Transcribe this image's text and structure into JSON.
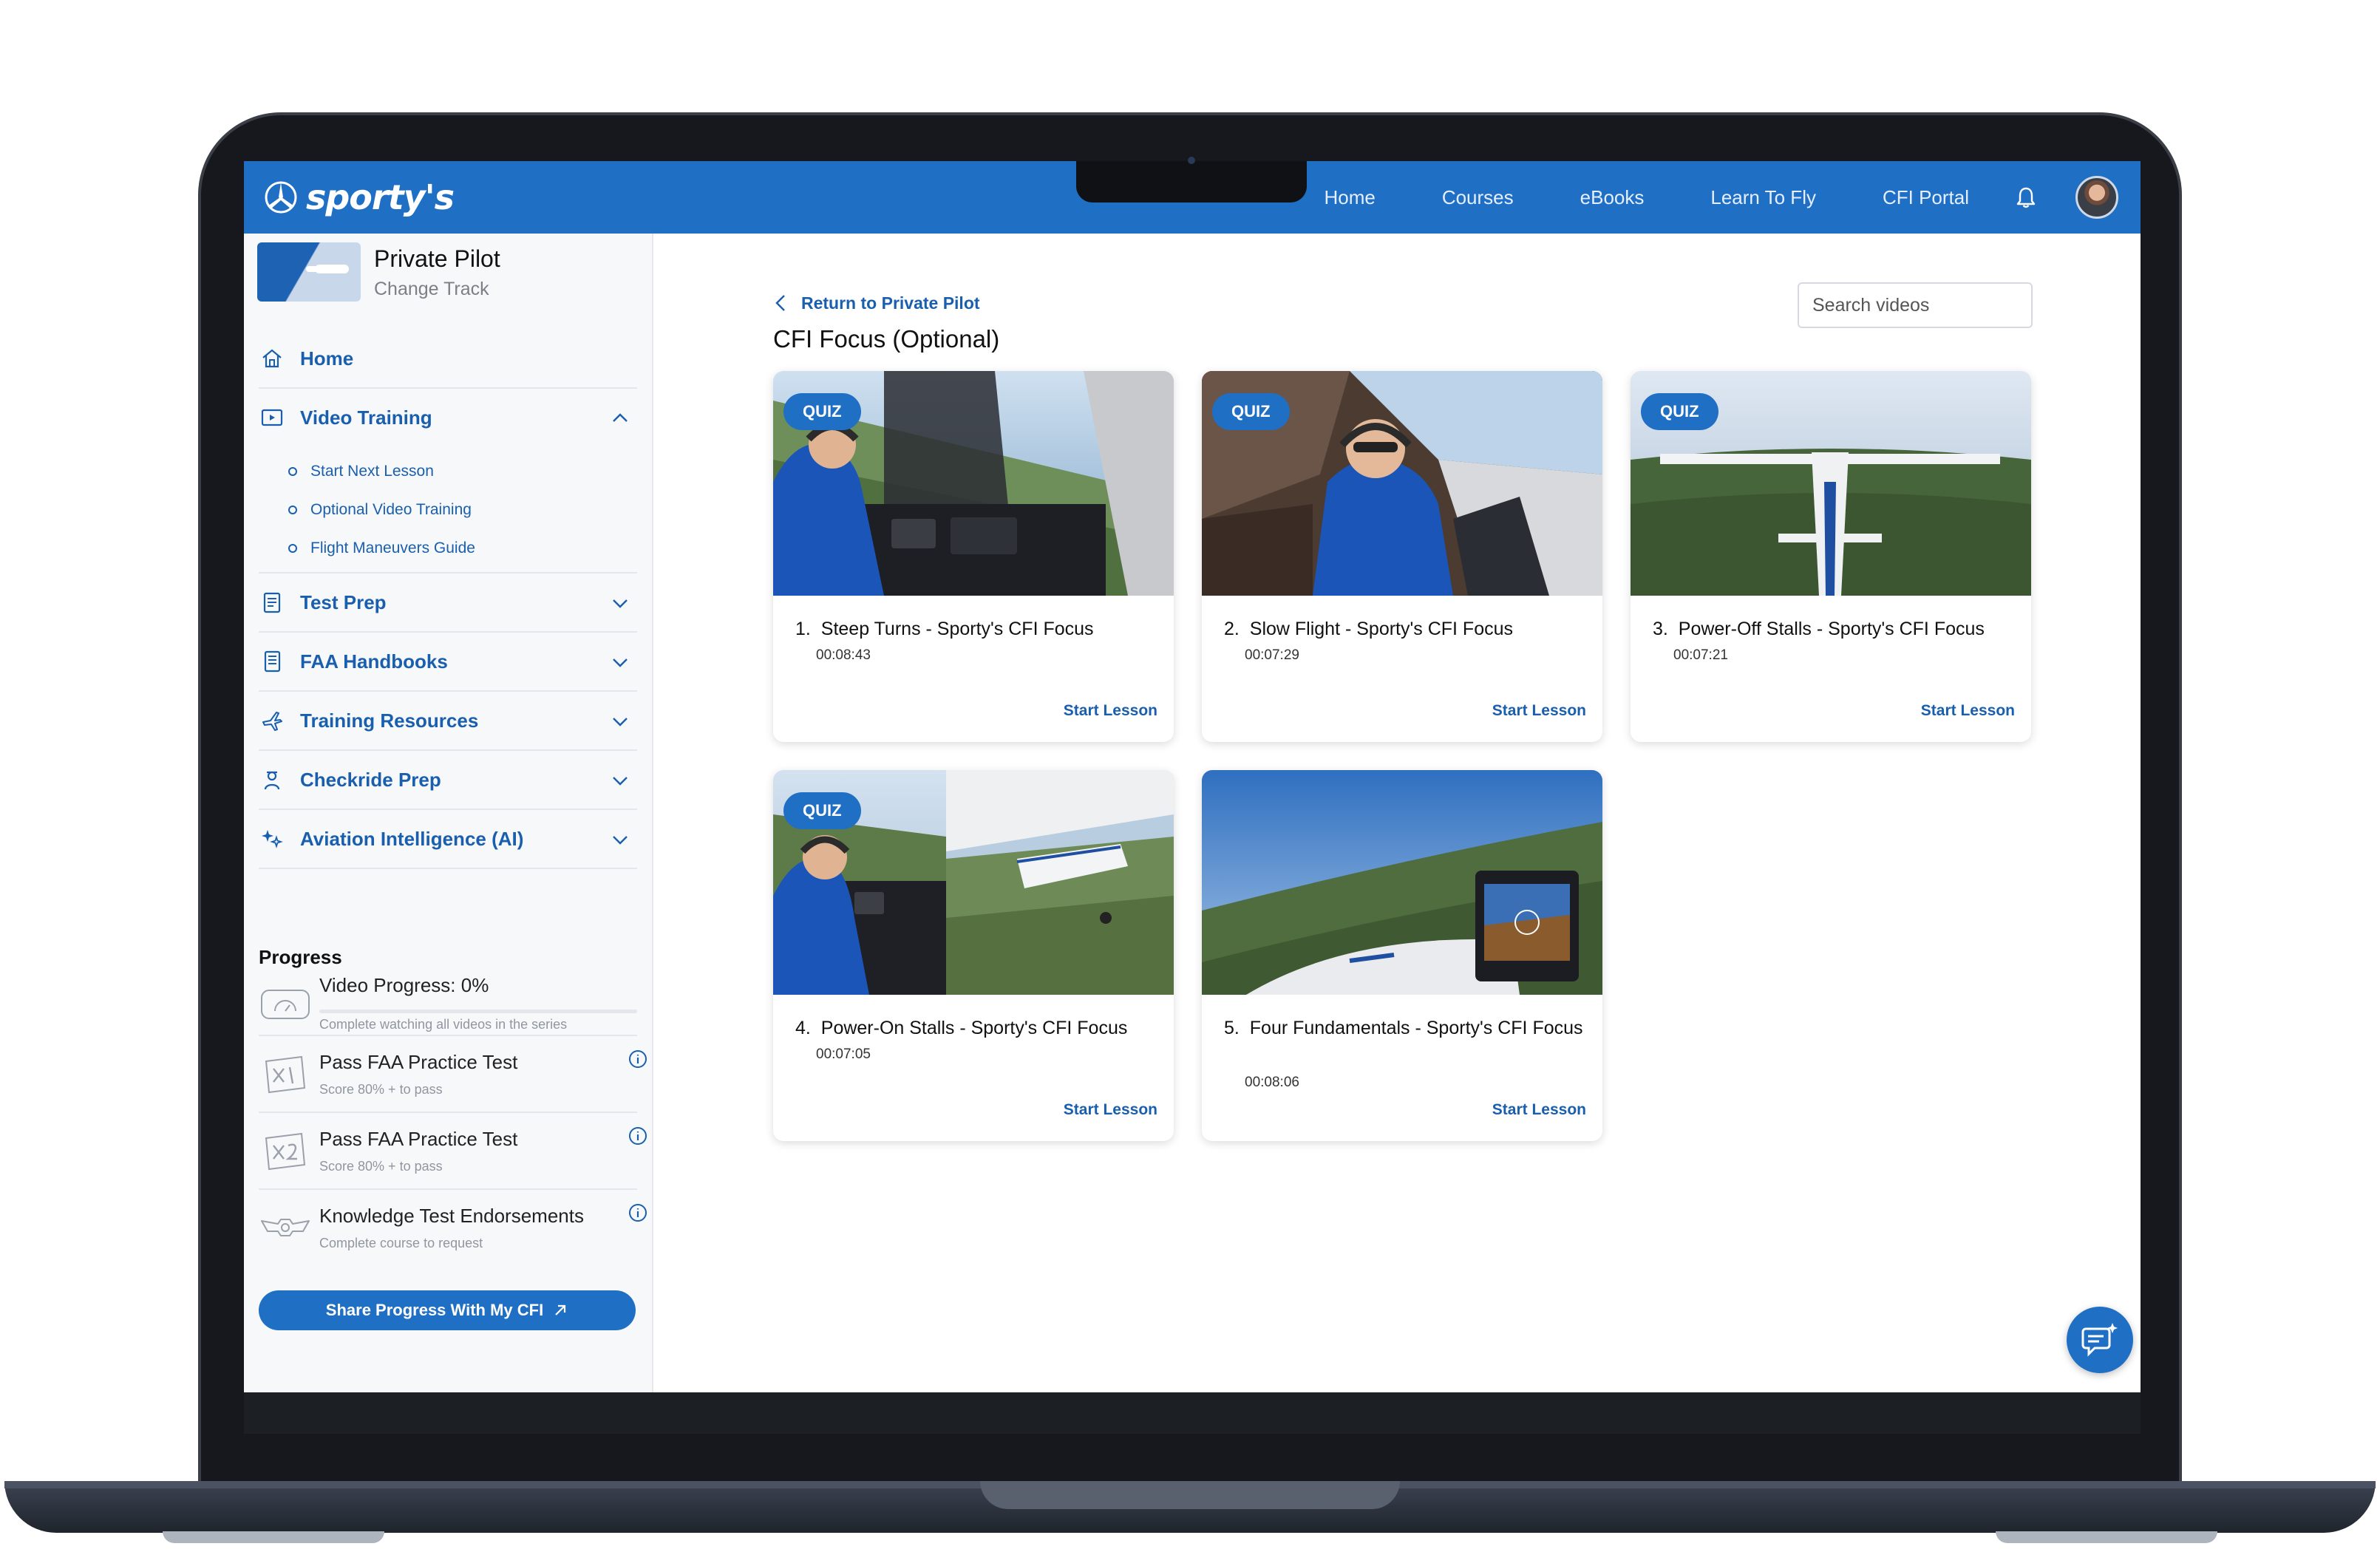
{
  "topnav": {
    "logo_text": "sporty's",
    "links": [
      "Home",
      "Courses",
      "eBooks",
      "Learn To Fly",
      "CFI Portal"
    ],
    "bell_icon": "bell-icon",
    "avatar_icon": "user-avatar"
  },
  "sidebar": {
    "track": {
      "title": "Private Pilot",
      "subtitle": "Change Track"
    },
    "home_label": "Home",
    "video_training": {
      "label": "Video Training",
      "subitems": [
        "Start Next Lesson",
        "Optional Video Training",
        "Flight Maneuvers Guide"
      ]
    },
    "sections": [
      "Test Prep",
      "FAA Handbooks",
      "Training Resources",
      "Checkride Prep",
      "Aviation Intelligence (AI)"
    ],
    "progress": {
      "title": "Progress",
      "items": [
        {
          "title": "Video Progress: 0%",
          "subtitle": "Complete watching all videos in the series",
          "value": 0
        },
        {
          "title": "Pass FAA Practice Test",
          "subtitle": "Score 80% + to pass"
        },
        {
          "title": "Pass FAA Practice Test",
          "subtitle": "Score 80% + to pass"
        },
        {
          "title": "Knowledge Test Endorsements",
          "subtitle": "Complete course to request"
        }
      ]
    },
    "share_button": "Share Progress With My CFI"
  },
  "main": {
    "back_label": "Return to Private Pilot",
    "title": "CFI Focus (Optional)",
    "search_placeholder": "Search videos",
    "badge": "QUIZ",
    "start_label": "Start Lesson",
    "videos": [
      {
        "number": "1.",
        "title": "Steep Turns - Sporty's CFI Focus",
        "duration": "00:08:43",
        "quiz": true
      },
      {
        "number": "2.",
        "title": "Slow Flight - Sporty's CFI Focus",
        "duration": "00:07:29",
        "quiz": true
      },
      {
        "number": "3.",
        "title": "Power-Off Stalls - Sporty's CFI Focus",
        "duration": "00:07:21",
        "quiz": true
      },
      {
        "number": "4.",
        "title": "Power-On Stalls - Sporty's CFI Focus",
        "duration": "00:07:05",
        "quiz": true
      },
      {
        "number": "5.",
        "title": "Four Fundamentals - Sporty's CFI Focus",
        "duration": "00:08:06",
        "quiz": false
      }
    ]
  },
  "colors": {
    "brand_blue": "#1f6fc5",
    "link_blue": "#1a5fae",
    "sidebar_bg": "#f7f8fa"
  },
  "chat_fab_icon": "ai-chat-icon"
}
